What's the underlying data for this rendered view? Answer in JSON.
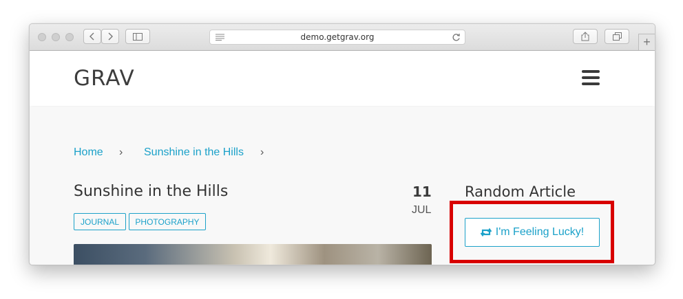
{
  "browser": {
    "url": "demo.getgrav.org",
    "icons": [
      "back-icon",
      "forward-icon",
      "sidebar-icon",
      "reader-icon",
      "reload-icon",
      "share-icon",
      "tabs-icon",
      "plus-icon"
    ]
  },
  "site": {
    "logo": "GRAV"
  },
  "breadcrumb": {
    "home": "Home",
    "current": "Sunshine in the Hills",
    "separator": "›"
  },
  "post": {
    "title": "Sunshine in the Hills",
    "tags": [
      "JOURNAL",
      "PHOTOGRAPHY"
    ],
    "date_day": "11",
    "date_month": "JUL"
  },
  "sidebar": {
    "title": "Random Article",
    "button_label": "I'm Feeling Lucky!",
    "button_icon": "retweet-icon"
  },
  "colors": {
    "accent": "#1ba1c9",
    "highlight": "#d80000",
    "text": "#333333"
  }
}
